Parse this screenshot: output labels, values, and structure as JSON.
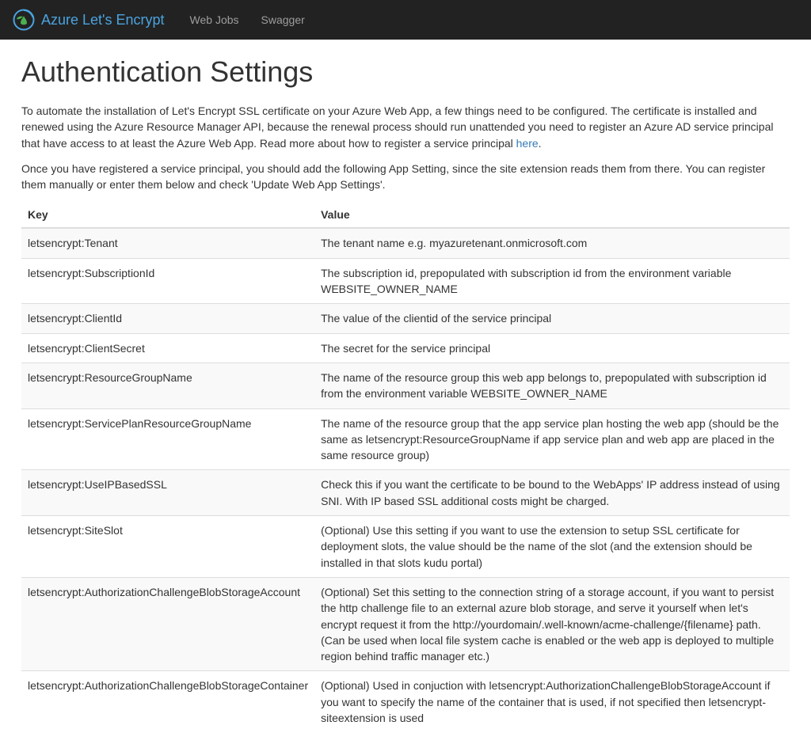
{
  "navbar": {
    "brand": "Azure Let's Encrypt",
    "links": [
      {
        "label": "Web Jobs"
      },
      {
        "label": "Swagger"
      }
    ]
  },
  "page": {
    "title": "Authentication Settings",
    "intro1_pre": "To automate the installation of Let's Encrypt SSL certificate on your Azure Web App, a few things need to be configured. The certificate is installed and renewed using the Azure Resource Manager API, because the renewal process should run unattended you need to register an Azure AD service principal that have access to at least the Azure Web App. Read more about how to register a service principal ",
    "intro1_link": "here",
    "intro1_post": ".",
    "intro2": "Once you have registered a service principal, you should add the following App Setting, since the site extension reads them from there. You can register them manually or enter them below and check 'Update Web App Settings'."
  },
  "table": {
    "headers": {
      "key": "Key",
      "value": "Value"
    },
    "rows": [
      {
        "key": "letsencrypt:Tenant",
        "value": "The tenant name e.g. myazuretenant.onmicrosoft.com"
      },
      {
        "key": "letsencrypt:SubscriptionId",
        "value": "The subscription id, prepopulated with subscription id from the environment variable WEBSITE_OWNER_NAME"
      },
      {
        "key": "letsencrypt:ClientId",
        "value": "The value of the clientid of the service principal"
      },
      {
        "key": "letsencrypt:ClientSecret",
        "value": "The secret for the service principal"
      },
      {
        "key": "letsencrypt:ResourceGroupName",
        "value": "The name of the resource group this web app belongs to, prepopulated with subscription id from the environment variable WEBSITE_OWNER_NAME"
      },
      {
        "key": "letsencrypt:ServicePlanResourceGroupName",
        "value": "The name of the resource group that the app service plan hosting the web app (should be the same as letsencrypt:ResourceGroupName if app service plan and web app are placed in the same resource group)"
      },
      {
        "key": "letsencrypt:UseIPBasedSSL",
        "value": "Check this if you want the certificate to be bound to the WebApps' IP address instead of using SNI. With IP based SSL additional costs might be charged."
      },
      {
        "key": "letsencrypt:SiteSlot",
        "value": "(Optional) Use this setting if you want to use the extension to setup SSL certificate for deployment slots, the value should be the name of the slot (and the extension should be installed in that slots kudu portal)"
      },
      {
        "key": "letsencrypt:AuthorizationChallengeBlobStorageAccount",
        "value": "(Optional) Set this setting to the connection string of a storage account, if you want to persist the http challenge file to an external azure blob storage, and serve it yourself when let's encrypt request it from the http://yourdomain/.well-known/acme-challenge/{filename} path. (Can be used when local file system cache is enabled or the web app is deployed to multiple region behind traffic manager etc.)"
      },
      {
        "key": "letsencrypt:AuthorizationChallengeBlobStorageContainer",
        "value": "(Optional) Used in conjuction with letsencrypt:AuthorizationChallengeBlobStorageAccount if you want to specify the name of the container that is used, if not specified then letsencrypt-siteextension is used"
      }
    ]
  }
}
